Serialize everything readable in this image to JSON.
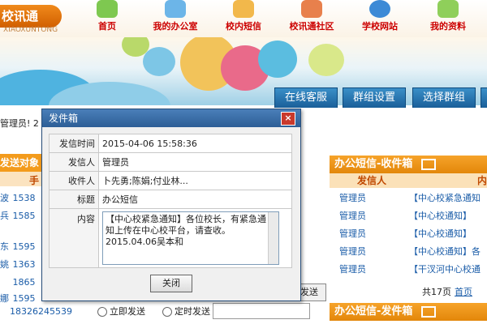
{
  "brand": {
    "logo_text": "校讯通",
    "logo_sub": "XIAOXUNTONG"
  },
  "nav": [
    {
      "label": "首页",
      "icon": "home-icon",
      "color": "#7ec850"
    },
    {
      "label": "我的办公室",
      "icon": "office-icon",
      "color": "#6cb5e8"
    },
    {
      "label": "校内短信",
      "icon": "sms-icon",
      "color": "#f2b84b"
    },
    {
      "label": "校讯通社区",
      "icon": "community-icon",
      "color": "#e8804c"
    },
    {
      "label": "学校网站",
      "icon": "ie-icon",
      "color": "#3d8ad6"
    },
    {
      "label": "我的资料",
      "icon": "profile-icon",
      "color": "#8fcf5a"
    }
  ],
  "tabs": [
    "在线客服",
    "群组设置",
    "选择群组"
  ],
  "welcome": "管理员! 2",
  "left_panel": {
    "header": "发送对象",
    "sub_header": "手",
    "rows": [
      {
        "name": "波",
        "phone": "1538"
      },
      {
        "name": "兵",
        "phone": "1585"
      },
      {
        "name": "东",
        "phone": "1595"
      },
      {
        "name": "姚",
        "phone": "1363"
      },
      {
        "name": "",
        "phone": "1865"
      },
      {
        "name": "娜",
        "phone": "1595"
      }
    ],
    "last_phone": "18326245539",
    "send_label": "发送",
    "option_now": "立即发送",
    "option_timed": "定时发送"
  },
  "inbox": {
    "title": "办公短信-收件箱",
    "col_sender": "发信人",
    "col_content": "内",
    "rows": [
      {
        "sender": "管理员",
        "subject": "【中心校紧急通知"
      },
      {
        "sender": "管理员",
        "subject": "【中心校通知】"
      },
      {
        "sender": "管理员",
        "subject": "【中心校通知】"
      },
      {
        "sender": "管理员",
        "subject": "【中心校通知】各"
      },
      {
        "sender": "管理员",
        "subject": "【干汊河中心校通"
      }
    ],
    "total": "共17页",
    "first_page": "首页"
  },
  "outbox_title": "办公短信-发件箱",
  "modal": {
    "title": "发件箱",
    "close_symbol": "×",
    "fields": [
      {
        "key": "发信时间",
        "value": "2015-04-06 15:58:36"
      },
      {
        "key": "发信人",
        "value": "管理员"
      },
      {
        "key": "收件人",
        "value": "卜先勇;陈娟;付业林..."
      },
      {
        "key": "标题",
        "value": "办公短信"
      }
    ],
    "content_label": "内容",
    "content_text": "【中心校紧急通知】各位校长，有紧急通知上传在中心校平台，请查收。\n2015.04.06吴本和",
    "close_label": "关闭"
  }
}
